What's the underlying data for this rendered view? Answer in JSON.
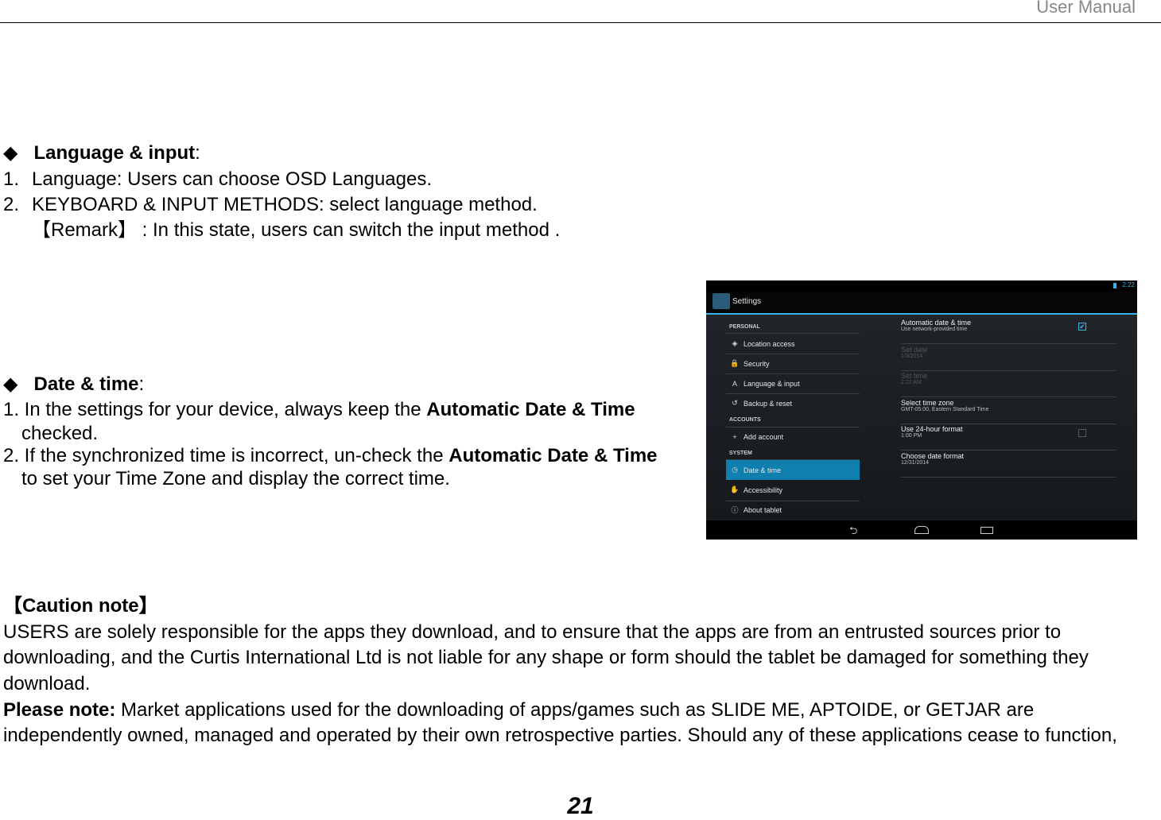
{
  "header": {
    "title": "User Manual"
  },
  "section1": {
    "bullet": "◆",
    "title": "Language & input",
    "colon": ":",
    "items": [
      "1.",
      "Language: Users can choose OSD Languages.",
      "2.",
      "KEYBOARD & INPUT METHODS: select language method."
    ],
    "remark": "【Remark】 : In this state, users can switch the input method ."
  },
  "section2": {
    "bullet": "◆",
    "title": "Date & time",
    "colon": ":",
    "l1a": "1. In the settings for your device, always keep the ",
    "l1b": "Automatic Date & Time",
    "l1c": "checked.",
    "l2a": "2. If the synchronized time is incorrect, un-check the ",
    "l2b": "Automatic Date & Time",
    "l2c": "to set your Time Zone and display the correct time."
  },
  "screenshot": {
    "status_time": "2:22",
    "app_title": "Settings",
    "accent": "#33b5e5",
    "selected_color": "#0f7fb0",
    "categories": [
      "PERSONAL",
      "ACCOUNTS",
      "SYSTEM"
    ],
    "menu": [
      {
        "icon": "location-icon",
        "glyph": "◈",
        "label": "Location access"
      },
      {
        "icon": "lock-icon",
        "glyph": "🔒",
        "label": "Security"
      },
      {
        "icon": "language-icon",
        "glyph": "A",
        "label": "Language & input"
      },
      {
        "icon": "backup-icon",
        "glyph": "↺",
        "label": "Backup & reset"
      },
      {
        "icon": "plus-icon",
        "glyph": "+",
        "label": "Add account"
      },
      {
        "icon": "clock-icon",
        "glyph": "◷",
        "label": "Date & time"
      },
      {
        "icon": "hand-icon",
        "glyph": "✋",
        "label": "Accessibility"
      },
      {
        "icon": "info-icon",
        "glyph": "ⓘ",
        "label": "About tablet"
      }
    ],
    "settings": [
      {
        "title": "Automatic date & time",
        "sub": "Use network-provided time",
        "checked": true
      },
      {
        "title": "Set date",
        "sub": "1/3/2014",
        "disabled": true
      },
      {
        "title": "Set time",
        "sub": "2:22 AM",
        "disabled": true
      },
      {
        "title": "Select time zone",
        "sub": "GMT-05:00, Eastern Standard Time"
      },
      {
        "title": "Use 24-hour format",
        "sub": "1:00 PM",
        "checked": false
      },
      {
        "title": "Choose date format",
        "sub": "12/31/2014"
      }
    ],
    "nav": [
      "back-icon",
      "home-icon",
      "recents-icon"
    ]
  },
  "caution": {
    "title": "【Caution note】",
    "lines": [
      "USERS are solely responsible for the apps they download, and to ensure that the apps are from an entrusted sources prior to",
      "downloading, and the Curtis International Ltd is not liable for any shape or form should the   tablet be damaged for something they",
      "download."
    ],
    "note_label": "Please note:",
    "note_a": " Market applications used for the downloading of apps/games such as SLIDE ME, APTOIDE, or GETJAR are",
    "note_b": "independently owned, managed and operated by their own retrospective parties. Should any of these applications cease to function,"
  },
  "page_number": "21"
}
